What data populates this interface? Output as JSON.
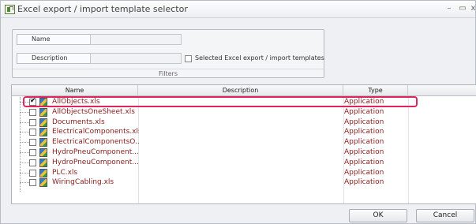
{
  "window": {
    "title": "Excel export / import template selector",
    "controls": {
      "minimize": "–",
      "maximize": "▭",
      "close": "x"
    }
  },
  "filters": {
    "name_label": "Name",
    "name_value": "",
    "description_label": "Description",
    "description_value": "",
    "selected_only_label": "Selected Excel export / import templates",
    "selected_only_checked": false,
    "caption": "Filters"
  },
  "grid": {
    "columns": [
      "Name",
      "Description",
      "Type"
    ],
    "rows": [
      {
        "name": "AllObjects.xls",
        "description": "",
        "type": "Application",
        "checked": true
      },
      {
        "name": "AllObjectsOneSheet.xls",
        "description": "",
        "type": "Application",
        "checked": false
      },
      {
        "name": "Documents.xls",
        "description": "",
        "type": "Application",
        "checked": false
      },
      {
        "name": "ElectricalComponents.xls",
        "description": "",
        "type": "Application",
        "checked": false
      },
      {
        "name": "ElectricalComponentsO...",
        "description": "",
        "type": "Application",
        "checked": false
      },
      {
        "name": "HydroPneuComponent...",
        "description": "",
        "type": "Application",
        "checked": false
      },
      {
        "name": "HydroPneuComponent...",
        "description": "",
        "type": "Application",
        "checked": false
      },
      {
        "name": "PLC.xls",
        "description": "",
        "type": "Application",
        "checked": false
      },
      {
        "name": "WiringCabling.xls",
        "description": "",
        "type": "Application",
        "checked": false
      }
    ],
    "highlight_color": "#e0245e",
    "name_text_color": "#8b1c1c"
  },
  "buttons": {
    "ok_label": "OK",
    "cancel_label": "Cancel"
  }
}
